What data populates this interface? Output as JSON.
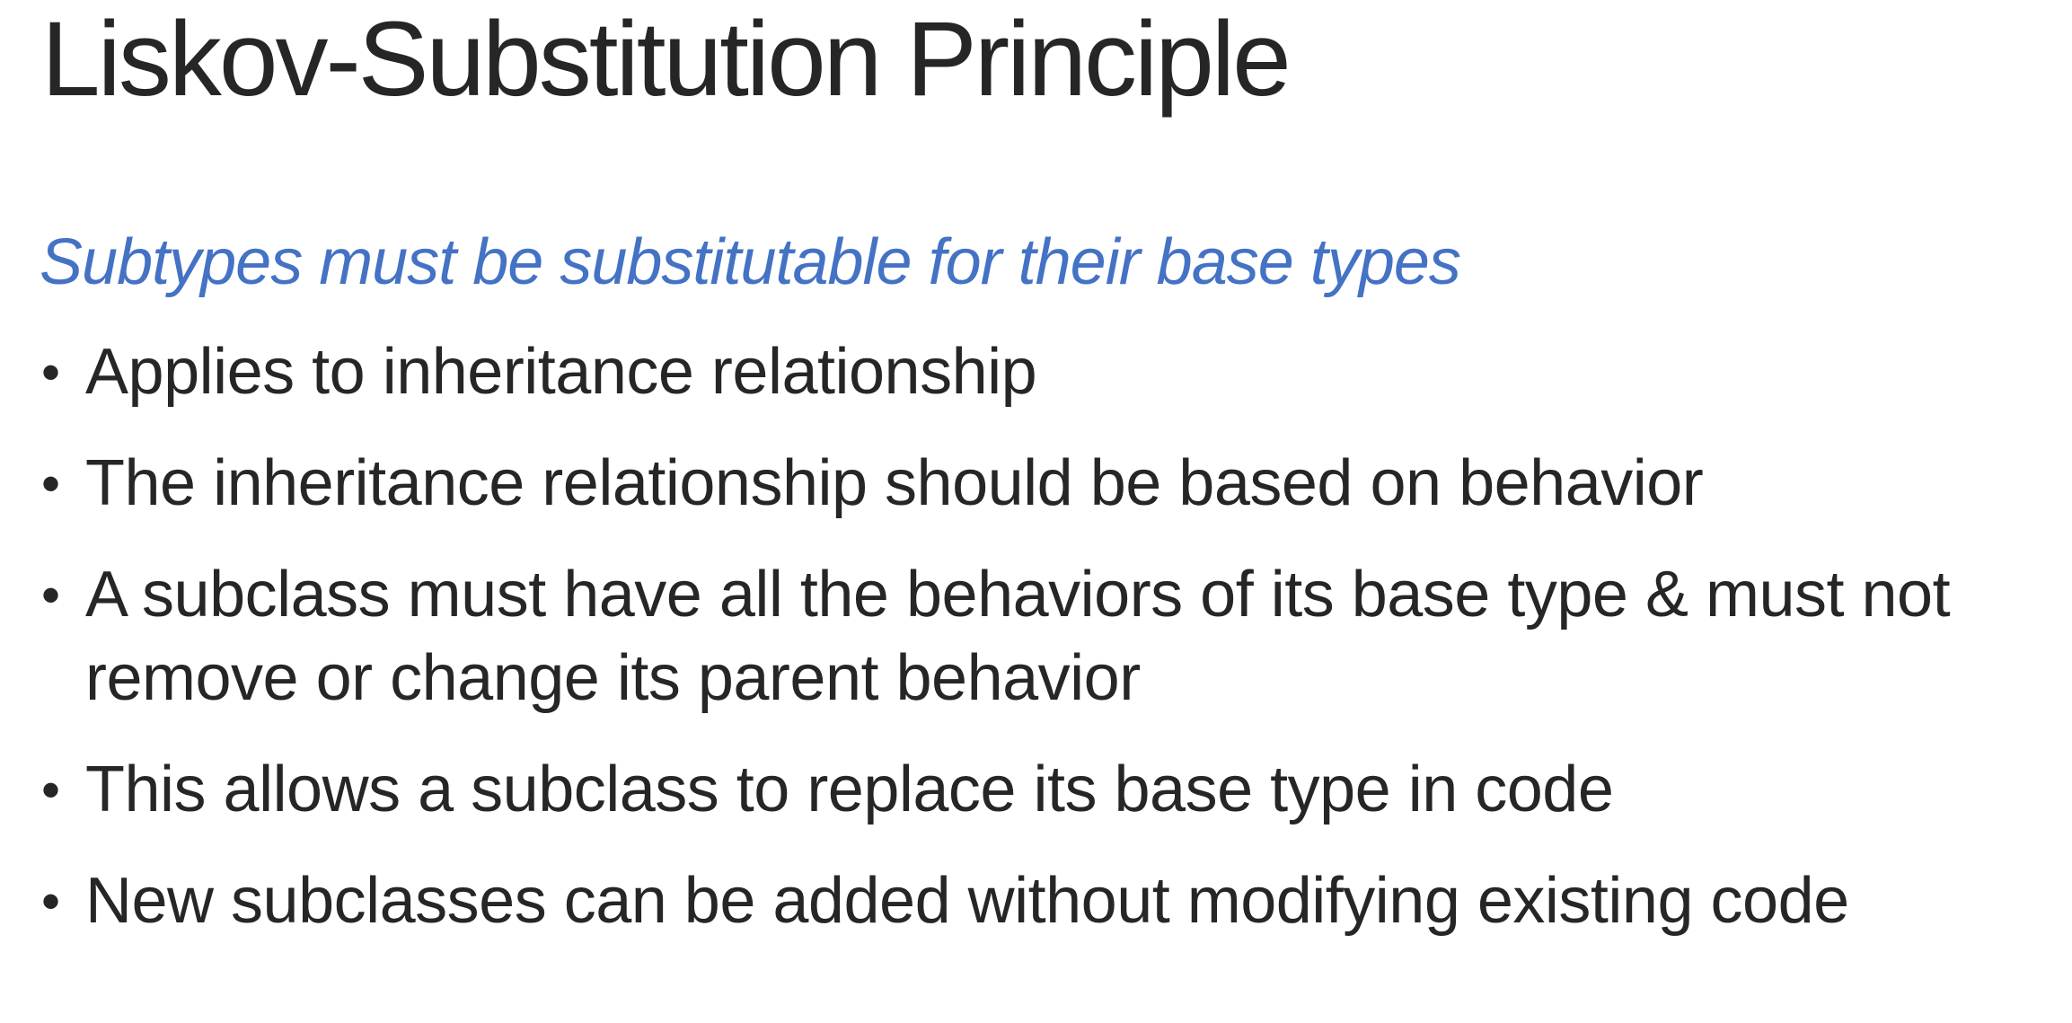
{
  "slide": {
    "title": "Liskov-Substitution Principle",
    "subtitle": "Subtypes must be substitutable for their base types",
    "accent_color": "#4472C4",
    "bullet_glyph": "•",
    "bullets": [
      "Applies to inheritance relationship",
      "The inheritance relationship should be based on behavior",
      "A subclass must have all the behaviors of its base type & must not remove or change its parent behavior",
      "This allows a subclass to replace its base type in code",
      "New subclasses can be added without modifying existing code"
    ]
  }
}
